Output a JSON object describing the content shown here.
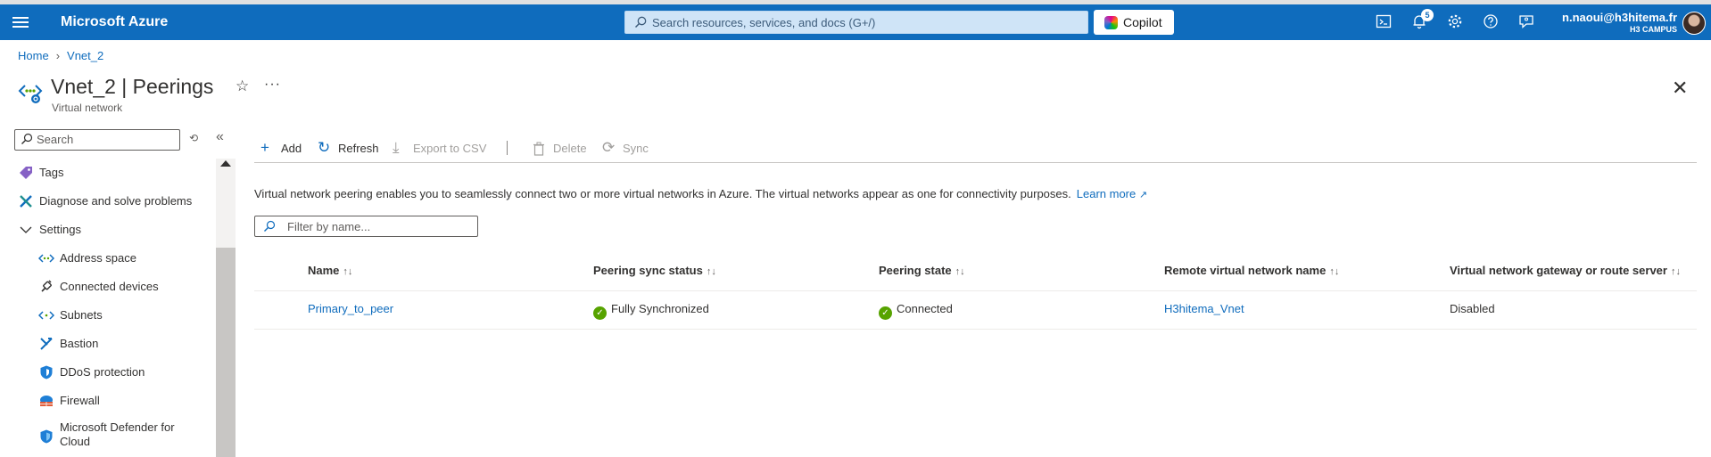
{
  "header": {
    "brand": "Microsoft Azure",
    "search_placeholder": "Search resources, services, and docs (G+/)",
    "copilot_label": "Copilot",
    "notification_count": "5",
    "account_email": "n.naoui@h3hitema.fr",
    "account_org": "H3 CAMPUS"
  },
  "breadcrumb": {
    "home": "Home",
    "current": "Vnet_2"
  },
  "page": {
    "title": "Vnet_2 | Peerings",
    "subtitle": "Virtual network",
    "star_glyph": "☆",
    "more_glyph": "···",
    "close_glyph": "✕"
  },
  "sidebar": {
    "search_placeholder": "Search",
    "items": [
      {
        "label": "Tags",
        "icon": "tag-icon"
      },
      {
        "label": "Diagnose and solve problems",
        "icon": "wrench-icon"
      },
      {
        "label": "Settings",
        "icon": "chevron-down-icon"
      },
      {
        "label": "Address space",
        "icon": "address-space-icon"
      },
      {
        "label": "Connected devices",
        "icon": "plug-icon"
      },
      {
        "label": "Subnets",
        "icon": "subnet-icon"
      },
      {
        "label": "Bastion",
        "icon": "bastion-icon"
      },
      {
        "label": "DDoS protection",
        "icon": "shield-icon"
      },
      {
        "label": "Firewall",
        "icon": "firewall-icon"
      },
      {
        "label": "Microsoft Defender for Cloud",
        "icon": "defender-icon"
      }
    ]
  },
  "toolbar": {
    "add": "Add",
    "refresh": "Refresh",
    "export": "Export to CSV",
    "delete": "Delete",
    "sync": "Sync"
  },
  "content": {
    "description": "Virtual network peering enables you to seamlessly connect two or more virtual networks in Azure. The virtual networks appear as one for connectivity purposes.",
    "learn_more": "Learn more",
    "filter_placeholder": "Filter by name..."
  },
  "table": {
    "columns": [
      "Name",
      "Peering sync status",
      "Peering state",
      "Remote virtual network name",
      "Virtual network gateway or route server"
    ],
    "rows": [
      {
        "name": "Primary_to_peer",
        "sync_status": "Fully Synchronized",
        "state": "Connected",
        "remote_vnet": "H3hitema_Vnet",
        "gateway": "Disabled"
      }
    ]
  },
  "colors": {
    "header_bg": "#0f6cbd",
    "link": "#0f6cbd",
    "success": "#57a300"
  }
}
